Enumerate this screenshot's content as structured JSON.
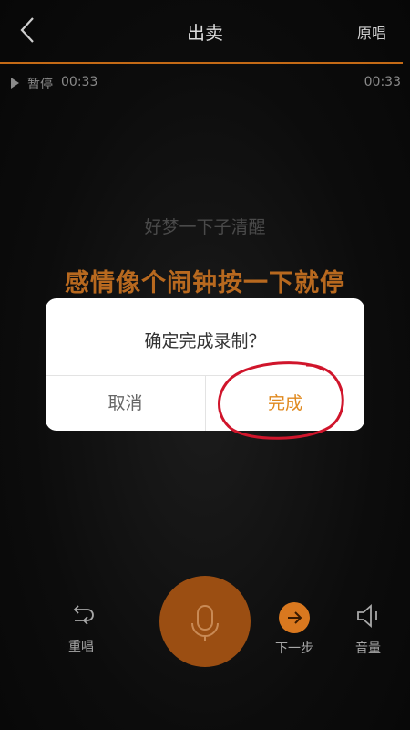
{
  "header": {
    "title": "出卖",
    "original_label": "原唱"
  },
  "status": {
    "pause_label": "暂停",
    "current_time": "00:33",
    "total_time": "00:33"
  },
  "lyrics": {
    "previous": "好梦一下子清醒",
    "current": "感情像个闹钟按一下就停"
  },
  "dialog": {
    "message": "确定完成录制？",
    "cancel_label": "取消",
    "confirm_label": "完成"
  },
  "controls": {
    "redo_label": "重唱",
    "next_label": "下一步",
    "volume_label": "音量"
  },
  "colors": {
    "accent": "#d9781f",
    "lyric_current": "#b8691f",
    "progress": "#c46a16",
    "annotation": "#d0152b",
    "mic_button": "#9b4e12"
  },
  "icons": {
    "back": "chevron-left-icon",
    "play": "play-icon",
    "redo": "redo-icon",
    "mic": "microphone-icon",
    "next": "arrow-right-icon",
    "volume": "speaker-icon"
  }
}
